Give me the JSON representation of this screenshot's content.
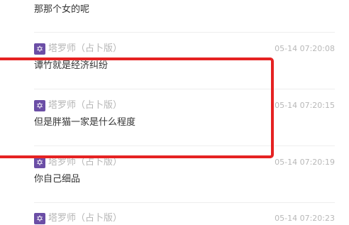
{
  "messages": [
    {
      "author": "",
      "time": "",
      "text": "那那个女的呢"
    },
    {
      "author": "塔罗师（占卜版）",
      "time": "05-14 07:20:08",
      "text": "谭竹就是经济纠纷"
    },
    {
      "author": "塔罗师（占卜版）",
      "time": "05-14 07:20:15",
      "text": "但是胖猫一家是什么程度"
    },
    {
      "author": "塔罗师（占卜版）",
      "time": "05-14 07:20:19",
      "text": "你自己细品"
    },
    {
      "author": "塔罗师（占卜版）",
      "time": "05-14 07:20:23",
      "text": ""
    }
  ],
  "avatar_icon": "star-of-david-icon",
  "avatar_glyph": "✡",
  "colors": {
    "badge": "#6b4ea6",
    "annotation": "#e52222",
    "author": "#b5b5b5",
    "text": "#333333"
  }
}
